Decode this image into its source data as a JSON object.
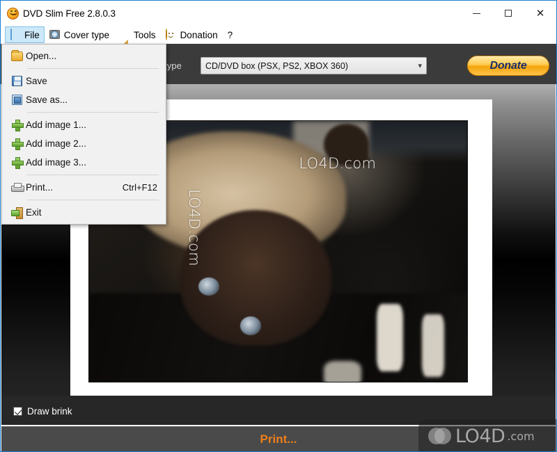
{
  "window": {
    "title": "DVD Slim Free 2.8.0.3",
    "app_icon": "smiley-icon",
    "controls": {
      "minimize": "minimize-icon",
      "maximize": "maximize-icon",
      "close": "close-icon"
    }
  },
  "menubar": {
    "items": [
      {
        "label": "File",
        "icon": "page-icon",
        "active": true
      },
      {
        "label": "Cover type",
        "icon": "cd-icon",
        "active": false
      },
      {
        "label": "Tools",
        "icon": "ruler-icon",
        "active": false
      },
      {
        "label": "Donation",
        "icon": "smiley-icon",
        "active": false
      },
      {
        "label": "?",
        "icon": "help-icon",
        "active": false
      }
    ]
  },
  "file_menu": {
    "open_label": "Open...",
    "save_label": "Save",
    "save_as_label": "Save as...",
    "add_image_1_label": "Add image 1...",
    "add_image_2_label": "Add image 2...",
    "add_image_3_label": "Add image 3...",
    "print_label": "Print...",
    "print_accel": "Ctrl+F12",
    "exit_label": "Exit"
  },
  "toolbar": {
    "cover_type_label": "Cover type",
    "cover_type_value": "CD/DVD box (PSX, PS2, XBOX 360)",
    "donate_label": "Donate",
    "donate_color": "#f3a40d"
  },
  "preview": {
    "watermark_horizontal": "LO4D.com",
    "watermark_vertical": "LO4D.com"
  },
  "options": {
    "draw_brink_label": "Draw brink",
    "draw_brink_checked": true
  },
  "footer": {
    "print_label": "Print...",
    "print_color": "#ef7f1a"
  },
  "corner_logo": {
    "name": "LO4D",
    "tld": ".com"
  }
}
